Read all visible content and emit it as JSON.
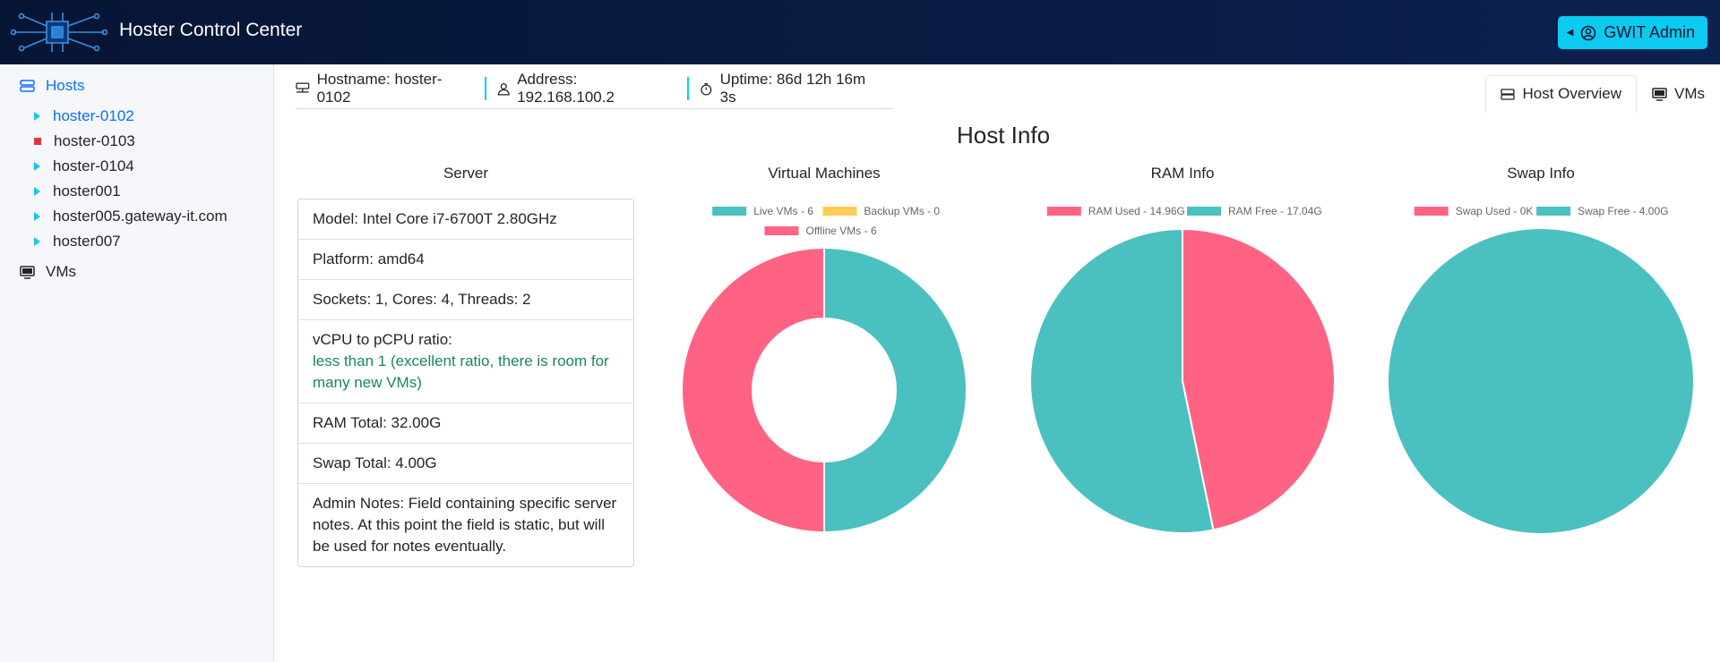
{
  "header": {
    "title": "Hoster Control Center",
    "admin_label": "GWIT Admin"
  },
  "sidebar": {
    "hosts_label": "Hosts",
    "hosts": [
      {
        "label": "hoster-0102",
        "status": "up"
      },
      {
        "label": "hoster-0103",
        "status": "down"
      },
      {
        "label": "hoster-0104",
        "status": "up"
      },
      {
        "label": "hoster001",
        "status": "up"
      },
      {
        "label": "hoster005.gateway-it.com",
        "status": "up"
      },
      {
        "label": "hoster007",
        "status": "up"
      }
    ],
    "vms_label": "VMs"
  },
  "infobar": {
    "hostname": "Hostname: hoster-0102",
    "address": "Address: 192.168.100.2",
    "uptime": "Uptime: 86d 12h 16m 3s"
  },
  "tabs": {
    "overview": "Host Overview",
    "vms": "VMs"
  },
  "main": {
    "title": "Host Info",
    "columns": {
      "server": "Server",
      "vms": "Virtual Machines",
      "ram": "RAM Info",
      "swap": "Swap Info"
    }
  },
  "server": {
    "model": "Model: Intel Core i7-6700T 2.80GHz",
    "platform": "Platform: amd64",
    "topology": "Sockets: 1, Cores: 4, Threads: 2",
    "ratio_label": "vCPU to pCPU ratio:",
    "ratio_value": "less than 1 (excellent ratio, there is room for many new VMs)",
    "ram_total": "RAM Total: 32.00G",
    "swap_total": "Swap Total: 4.00G",
    "notes": "Admin Notes: Field containing specific server notes. At this point the field is static, but will be used for notes eventually."
  },
  "colors": {
    "teal": "#4bc0c0",
    "pink": "#ff6384",
    "yellow": "#ffcd56",
    "accent": "#0dcaf0",
    "header": "#071535"
  },
  "chart_data": [
    {
      "type": "pie",
      "variant": "doughnut",
      "title": "Virtual Machines",
      "series": [
        {
          "name": "Live VMs - 6",
          "value": 6,
          "color": "#4bc0c0"
        },
        {
          "name": "Backup VMs - 0",
          "value": 0,
          "color": "#ffcd56"
        },
        {
          "name": "Offline VMs - 6",
          "value": 6,
          "color": "#ff6384"
        }
      ]
    },
    {
      "type": "pie",
      "title": "RAM Info",
      "series": [
        {
          "name": "RAM Used - 14.96G",
          "value": 14.96,
          "color": "#ff6384"
        },
        {
          "name": "RAM Free - 17.04G",
          "value": 17.04,
          "color": "#4bc0c0"
        }
      ]
    },
    {
      "type": "pie",
      "title": "Swap Info",
      "series": [
        {
          "name": "Swap Used - 0K",
          "value": 0,
          "color": "#ff6384"
        },
        {
          "name": "Swap Free - 4.00G",
          "value": 4.0,
          "color": "#4bc0c0"
        }
      ]
    }
  ]
}
